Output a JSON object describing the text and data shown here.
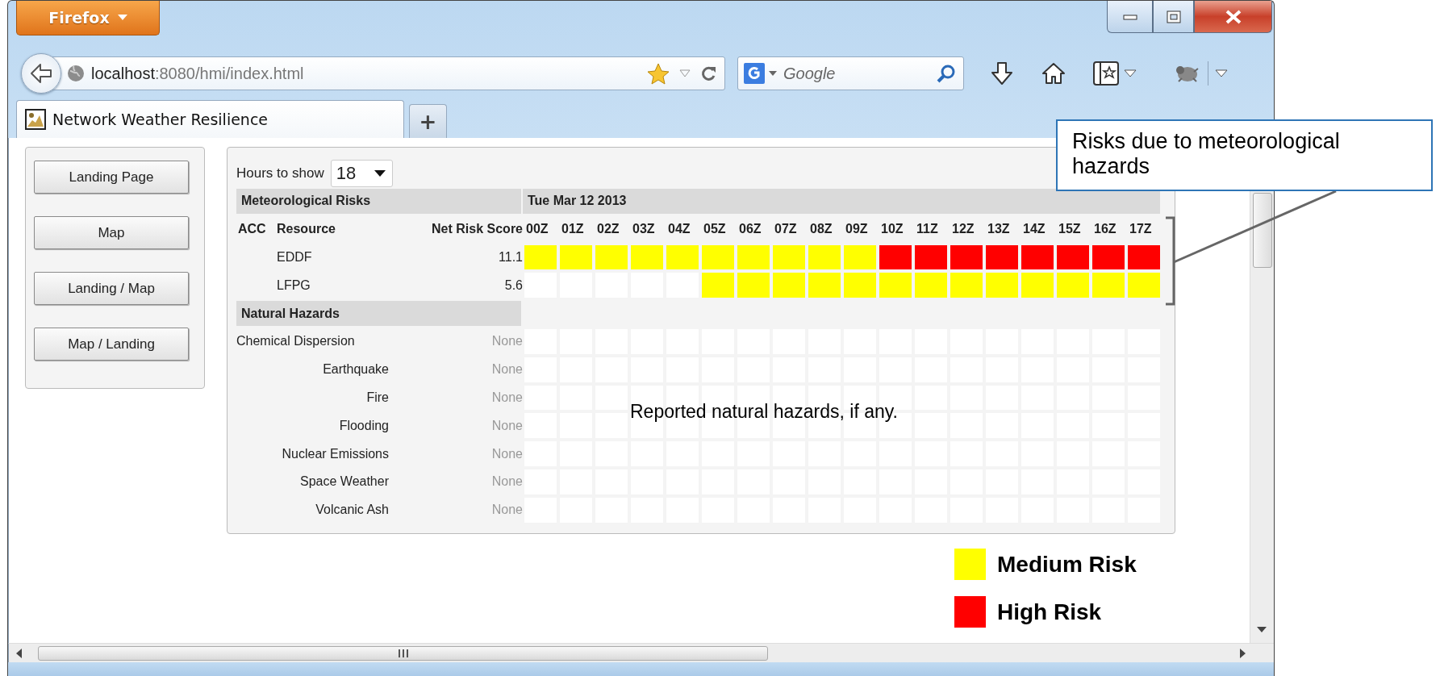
{
  "browser": {
    "menu_button": "Firefox",
    "url_host": "localhost",
    "url_path": ":8080/hmi/index.html",
    "search_placeholder": "Google",
    "tabs": [
      {
        "title": "Network Weather Resilience",
        "selected": true
      }
    ],
    "new_tab": "+"
  },
  "nav_buttons": [
    "Landing Page",
    "Map",
    "Landing / Map",
    "Map / Landing"
  ],
  "hours_to_show": {
    "label": "Hours to show",
    "value": "18"
  },
  "meteorological": {
    "title": "Meteorological Risks",
    "date": "Tue Mar 12 2013",
    "columns": [
      "ACC",
      "Resource",
      "Net Risk Score"
    ],
    "hours": [
      "00Z",
      "01Z",
      "02Z",
      "03Z",
      "04Z",
      "05Z",
      "06Z",
      "07Z",
      "08Z",
      "09Z",
      "10Z",
      "11Z",
      "12Z",
      "13Z",
      "14Z",
      "15Z",
      "16Z",
      "17Z"
    ],
    "rows": [
      {
        "resource": "EDDF",
        "score": "11.1",
        "cells": [
          {
            "color": "#ffff00"
          },
          {
            "color": "#ffff00"
          },
          {
            "color": "#ffff00"
          },
          {
            "color": "#ffff00"
          },
          {
            "color": "#ffff00"
          },
          {
            "color": "#ffff00"
          },
          {
            "color": "#ffff00"
          },
          {
            "color": "#ffff00"
          },
          {
            "color": "#ffff00"
          },
          {
            "color": "#ffff00"
          },
          {
            "color": "#ff0000"
          },
          {
            "color": "#ff0000"
          },
          {
            "color": "#ff0000"
          },
          {
            "color": "#ff0000"
          },
          {
            "color": "#ff0000"
          },
          {
            "color": "#ff0000"
          },
          {
            "color": "#ff0000"
          },
          {
            "color": "#ff0000"
          }
        ]
      },
      {
        "resource": "LFPG",
        "score": "5.6",
        "cells": [
          {
            "color": "#ffffff"
          },
          {
            "color": "#ffffff"
          },
          {
            "color": "#ffffff"
          },
          {
            "color": "#ffffff"
          },
          {
            "color": "#ffffff"
          },
          {
            "color": "#ffff00"
          },
          {
            "color": "#ffff00"
          },
          {
            "color": "#ffff00"
          },
          {
            "color": "#ffff00"
          },
          {
            "color": "#ffff00"
          },
          {
            "color": "#ffff00"
          },
          {
            "color": "#ffff00"
          },
          {
            "color": "#ffff00"
          },
          {
            "color": "#ffff00"
          },
          {
            "color": "#ffff00"
          },
          {
            "color": "#ffff00"
          },
          {
            "color": "#ffff00"
          },
          {
            "color": "#ffff00"
          }
        ]
      }
    ]
  },
  "natural_hazards": {
    "title": "Natural Hazards",
    "rows": [
      {
        "name": "Chemical Dispersion",
        "value": "None"
      },
      {
        "name": "Earthquake",
        "value": "None"
      },
      {
        "name": "Fire",
        "value": "None"
      },
      {
        "name": "Flooding",
        "value": "None"
      },
      {
        "name": "Nuclear Emissions",
        "value": "None"
      },
      {
        "name": "Space Weather",
        "value": "None"
      },
      {
        "name": "Volcanic Ash",
        "value": "None"
      }
    ]
  },
  "legend": [
    {
      "label": "Medium Risk",
      "color": "#ffff00"
    },
    {
      "label": "High Risk",
      "color": "#ff0000"
    }
  ],
  "annotations": [
    {
      "kind": "callout",
      "text": "Risks due to meteorological hazards"
    },
    {
      "kind": "note",
      "text": "Reported natural hazards, if any."
    }
  ]
}
